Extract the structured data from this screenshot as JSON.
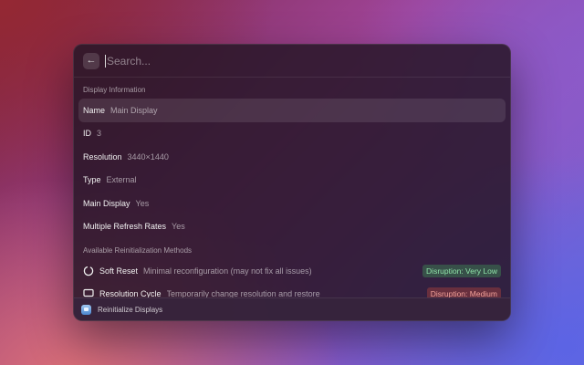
{
  "search": {
    "placeholder": "Search..."
  },
  "display_info": {
    "header": "Display Information",
    "fields": [
      {
        "label": "Name",
        "value": "Main Display"
      },
      {
        "label": "ID",
        "value": "3"
      },
      {
        "label": "Resolution",
        "value": "3440×1440"
      },
      {
        "label": "Type",
        "value": "External"
      },
      {
        "label": "Main Display",
        "value": "Yes"
      },
      {
        "label": "Multiple Refresh Rates",
        "value": "Yes"
      }
    ]
  },
  "methods": {
    "header": "Available Reinitialization Methods",
    "items": [
      {
        "icon": "circle-dashed-icon",
        "title": "Soft Reset",
        "description": "Minimal reconfiguration (may not fix all issues)",
        "badge": "Disruption: Very Low",
        "badge_color": "#8fe3a8"
      },
      {
        "icon": "monitor-icon",
        "title": "Resolution Cycle",
        "description": "Temporarily change resolution and restore",
        "badge": "Disruption: Medium",
        "badge_color": "#f3a29a"
      }
    ]
  },
  "footer": {
    "title": "Reinitialize Displays"
  }
}
